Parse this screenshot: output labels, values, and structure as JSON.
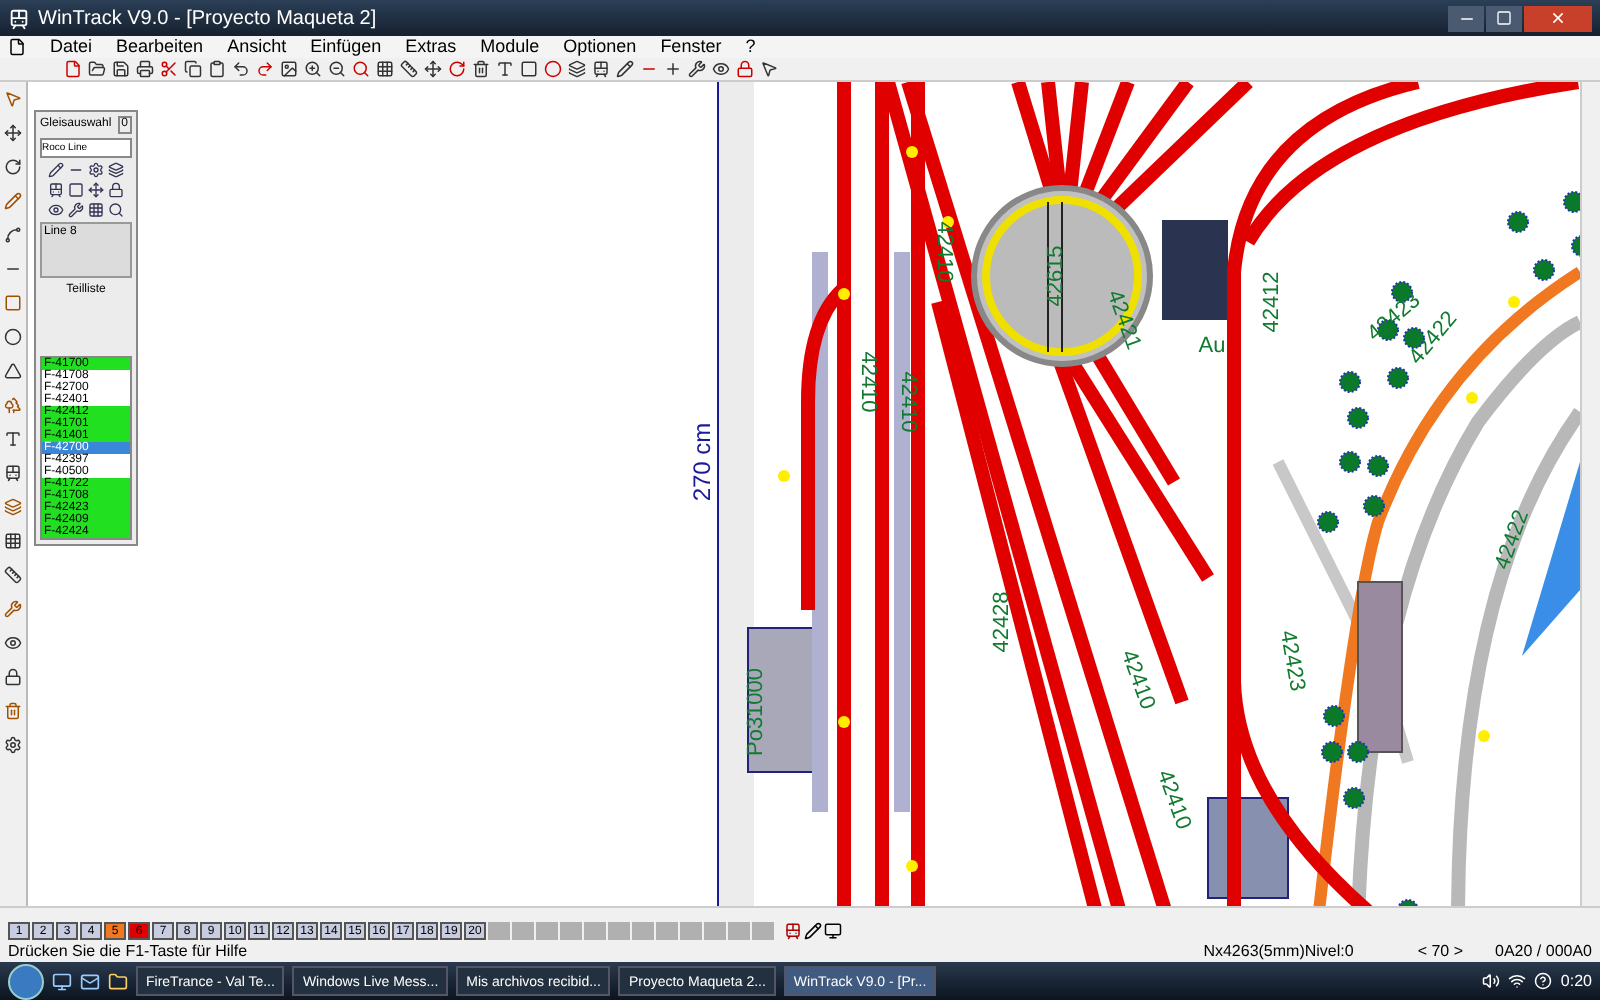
{
  "window": {
    "title": "WinTrack V9.0 - [Proyecto Maqueta 2]"
  },
  "menu": [
    "Datei",
    "Bearbeiten",
    "Ansicht",
    "Einfügen",
    "Extras",
    "Module",
    "Optionen",
    "Fenster",
    "?"
  ],
  "panel": {
    "title": "Gleisauswahl",
    "close": "0",
    "dropdown": "Roco Line",
    "preview": "Line 8",
    "caption": "Teilliste",
    "items": [
      {
        "label": "F-41700",
        "in_use": true,
        "selected": false
      },
      {
        "label": "F-41708",
        "in_use": false,
        "selected": false
      },
      {
        "label": "F-42700",
        "in_use": false,
        "selected": false
      },
      {
        "label": "F-42401",
        "in_use": false,
        "selected": false
      },
      {
        "label": "F-42412",
        "in_use": true,
        "selected": false
      },
      {
        "label": "F-41701",
        "in_use": true,
        "selected": false
      },
      {
        "label": "F-41401",
        "in_use": true,
        "selected": false
      },
      {
        "label": "F-42700",
        "in_use": false,
        "selected": true
      },
      {
        "label": "F-42397",
        "in_use": false,
        "selected": false
      },
      {
        "label": "F-40500",
        "in_use": false,
        "selected": false
      },
      {
        "label": "F-41722",
        "in_use": true,
        "selected": false
      },
      {
        "label": "F-41708",
        "in_use": true,
        "selected": false
      },
      {
        "label": "F-42423",
        "in_use": true,
        "selected": false
      },
      {
        "label": "F-42409",
        "in_use": true,
        "selected": false
      },
      {
        "label": "F-42424",
        "in_use": true,
        "selected": false
      }
    ]
  },
  "canvas": {
    "ruler": "270 cm",
    "labels": [
      "42615",
      "42410",
      "42410",
      "42410",
      "42410",
      "42428",
      "42412",
      "42422",
      "42423",
      "42423",
      "Au",
      "Po31000",
      "42421",
      "42410",
      "42422"
    ]
  },
  "layers": [
    {
      "label": "1"
    },
    {
      "label": "2"
    },
    {
      "label": "3"
    },
    {
      "label": "4"
    },
    {
      "label": "5",
      "color": "#f07820"
    },
    {
      "label": "6",
      "color": "#e00000"
    },
    {
      "label": "7"
    },
    {
      "label": "8"
    },
    {
      "label": "9"
    },
    {
      "label": "10"
    },
    {
      "label": "11"
    },
    {
      "label": "12"
    },
    {
      "label": "13"
    },
    {
      "label": "14"
    },
    {
      "label": "15"
    },
    {
      "label": "16"
    },
    {
      "label": "17"
    },
    {
      "label": "18"
    },
    {
      "label": "19"
    },
    {
      "label": "20"
    }
  ],
  "status_bar": {
    "help": "Drücken Sie die F1-Taste für Hilfe",
    "info": "Nx4263(5mm)Nivel:0",
    "zoom": "< 70 >",
    "coords": "0A20 / 000A0"
  },
  "taskbar": {
    "tasks": [
      {
        "label": "FireTrance - Val Te...",
        "selected": false
      },
      {
        "label": "Windows Live Mess...",
        "selected": false
      },
      {
        "label": "Mis archivos recibid...",
        "selected": false
      },
      {
        "label": "Proyecto Maqueta 2...",
        "selected": false
      },
      {
        "label": "WinTrack V9.0 - [Pr...",
        "selected": true
      }
    ],
    "clock": "0:20"
  }
}
